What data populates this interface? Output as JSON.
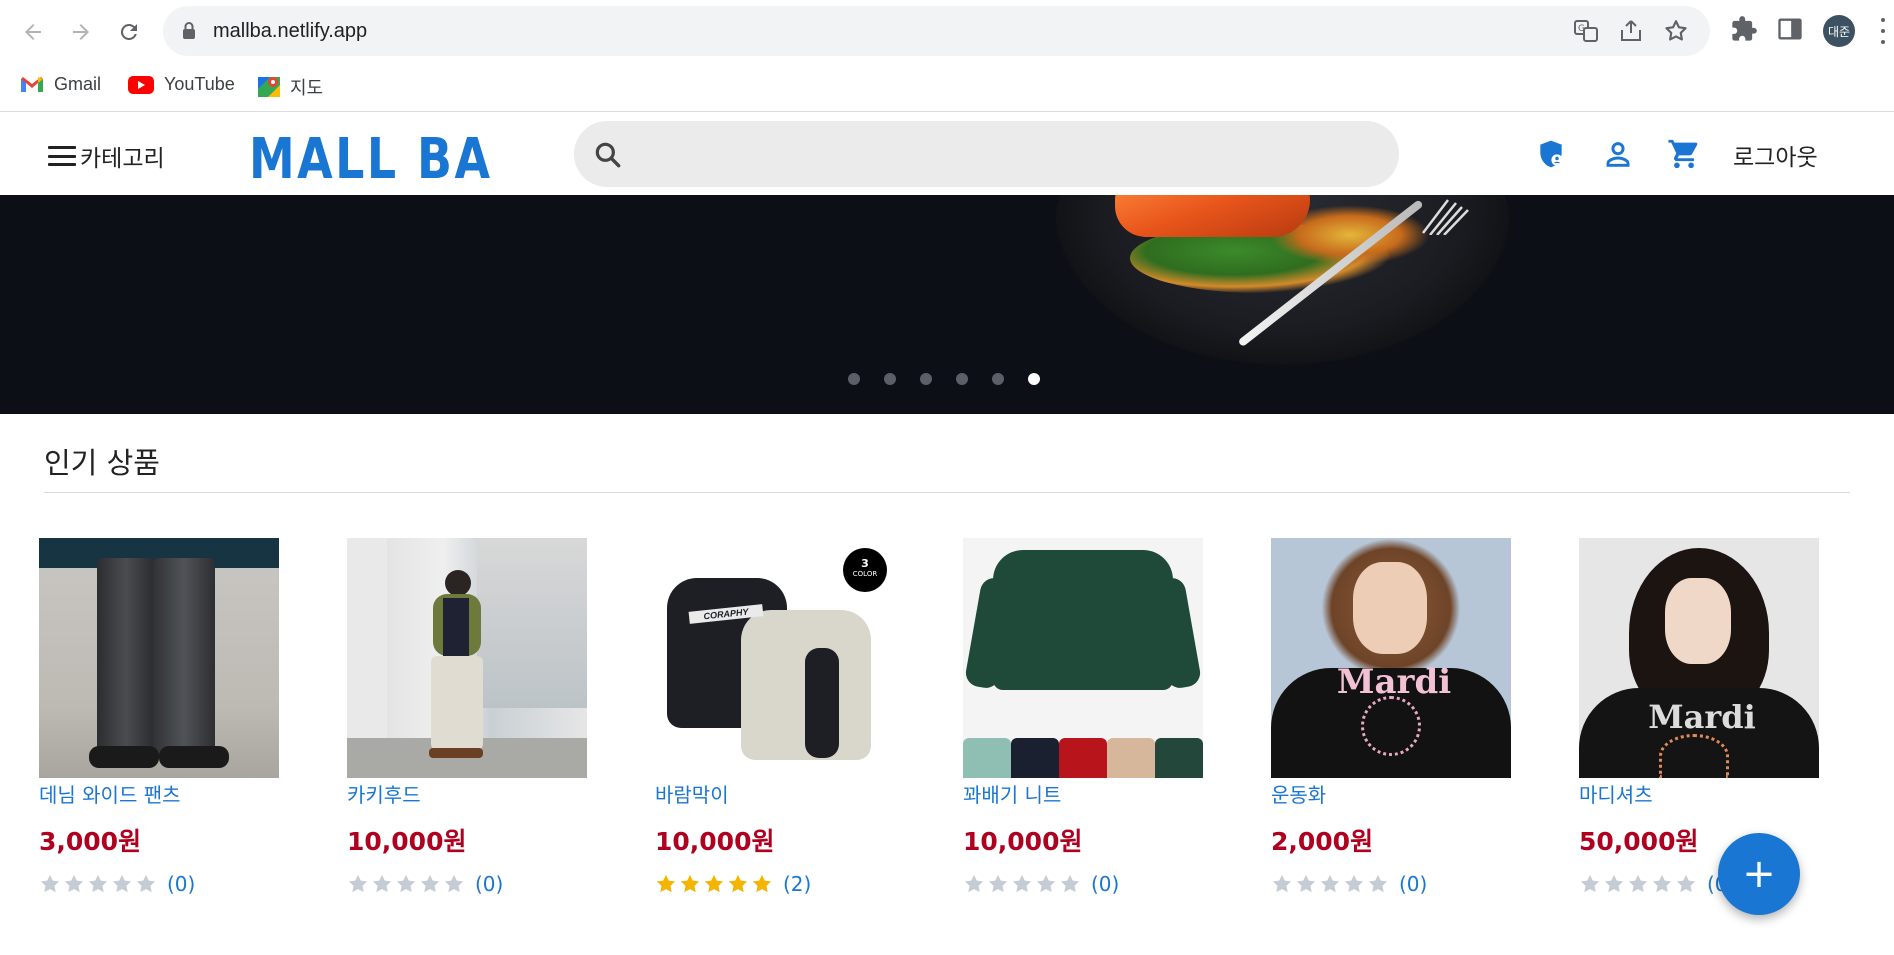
{
  "browser": {
    "url": "mallba.netlify.app",
    "profile_initials": "대준",
    "bookmarks": [
      {
        "label": "Gmail",
        "icon": "gmail-icon"
      },
      {
        "label": "YouTube",
        "icon": "youtube-icon"
      },
      {
        "label": "지도",
        "icon": "maps-icon"
      }
    ]
  },
  "header": {
    "category_label": "카테고리",
    "logo": "MALL BA",
    "search_placeholder": "",
    "logout_label": "로그아웃",
    "icons": [
      "shield-admin-icon",
      "user-icon",
      "cart-icon"
    ]
  },
  "banner": {
    "slide_count": 6,
    "active_slide": 6
  },
  "section": {
    "title": "인기 상품"
  },
  "products": [
    {
      "name": "데님 와이드 팬츠",
      "price": "3,000원",
      "rating": 0,
      "review_count": "(0)"
    },
    {
      "name": "카키후드",
      "price": "10,000원",
      "rating": 0,
      "review_count": "(0)"
    },
    {
      "name": "바람막이",
      "price": "10,000원",
      "rating": 5,
      "review_count": "(2)",
      "badge_num": "3",
      "badge_text": "COLOR",
      "logo_text": "CORAPHY"
    },
    {
      "name": "꽈배기 니트",
      "price": "10,000원",
      "rating": 0,
      "review_count": "(0)"
    },
    {
      "name": "운동화",
      "price": "2,000원",
      "rating": 0,
      "review_count": "(0)",
      "print_text": "Mardi"
    },
    {
      "name": "마디셔츠",
      "price": "50,000원",
      "rating": 0,
      "review_count": "(0)",
      "print_text": "Mardi"
    }
  ],
  "colors": {
    "brand_blue": "#1976d2",
    "price_red": "#b00020",
    "star_filled": "#f4b400",
    "star_empty": "#c5ccd6"
  },
  "fab_label": "+"
}
